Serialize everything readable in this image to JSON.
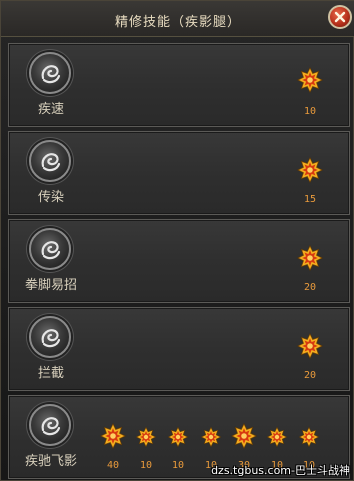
{
  "window": {
    "title": "精修技能（疾影腿）"
  },
  "skills": [
    {
      "name": "疾速",
      "levels": [
        "10"
      ]
    },
    {
      "name": "传染",
      "levels": [
        "15"
      ]
    },
    {
      "name": "拳脚易招",
      "levels": [
        "20"
      ]
    },
    {
      "name": "拦截",
      "levels": [
        "20"
      ]
    },
    {
      "name": "疾驰飞影",
      "levels": [
        "40",
        "10",
        "10",
        "10",
        "30",
        "10",
        "10"
      ]
    }
  ],
  "watermark": "dzs.tgbus.com-巴士斗战神",
  "colors": {
    "level_text": "#e89a3c",
    "star_outer": "#f4b020",
    "star_inner": "#d83a10",
    "title_text": "#e8dcc0"
  },
  "icons": {
    "skill": "swirl-rune-icon",
    "rank": "star-burst-icon",
    "close": "close-icon"
  }
}
